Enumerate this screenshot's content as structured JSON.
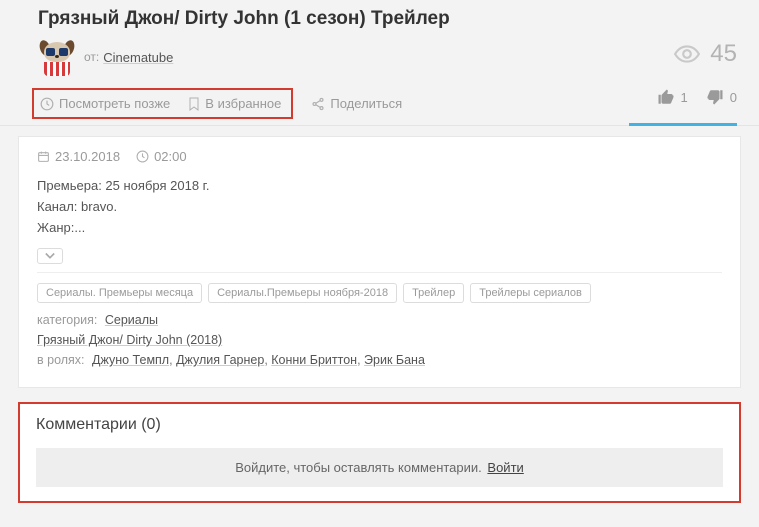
{
  "title": "Грязный Джон/ Dirty John (1 сезон) Трейлер",
  "author": {
    "from_label": "от:",
    "name": "Cinematube"
  },
  "views": {
    "count": "45"
  },
  "actions": {
    "watch_later": "Посмотреть позже",
    "favorite": "В избранное",
    "share": "Поделиться",
    "like_count": "1",
    "dislike_count": "0"
  },
  "meta": {
    "date": "23.10.2018",
    "duration": "02:00"
  },
  "description": {
    "line1": "Премьера: 25 ноября 2018 г.",
    "line2": "Канал: bravo.",
    "line3": "Жанр:..."
  },
  "tags": [
    "Сериалы. Премьеры месяца",
    "Сериалы.Премьеры ноября-2018",
    "Трейлер",
    "Трейлеры сериалов"
  ],
  "category": {
    "label": "категория:",
    "value": "Сериалы"
  },
  "title_link": "Грязный Джон/ Dirty John (2018)",
  "cast": {
    "label": "в ролях:",
    "items": [
      "Джуно Темпл",
      "Джулия Гарнер",
      "Конни Бриттон",
      "Эрик Бана"
    ]
  },
  "comments": {
    "title": "Комментарии (0)",
    "login_prompt": "Войдите, чтобы оставлять комментарии.",
    "login_link": "Войти"
  }
}
